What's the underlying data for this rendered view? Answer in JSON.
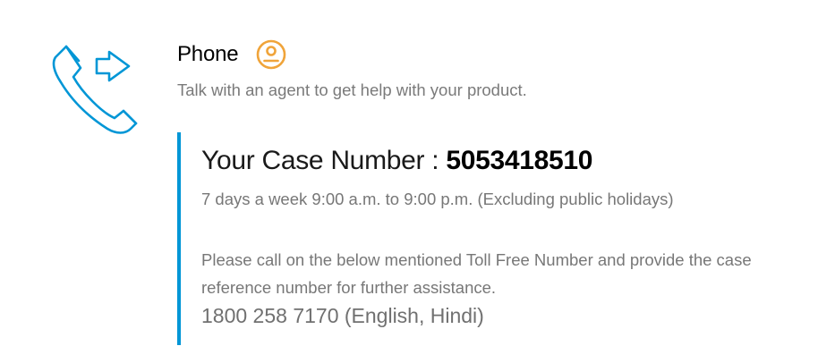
{
  "contact": {
    "title": "Phone",
    "subtitle": "Talk with an agent to get help with your product.",
    "icons": {
      "main": "phone-arrow-icon",
      "badge": "agent-icon"
    },
    "colors": {
      "accent": "#0096d6",
      "badge": "#f0a43a",
      "muted_text": "#777777"
    }
  },
  "case": {
    "label": "Your Case Number : ",
    "number": "5053418510",
    "hours": "7 days a week 9:00 a.m. to 9:00 p.m. (Excluding public holidays)",
    "instructions": "Please call on the below mentioned Toll Free Number and provide the case reference number for further assistance.",
    "toll_free": "1800 258 7170 (English, Hindi)"
  }
}
